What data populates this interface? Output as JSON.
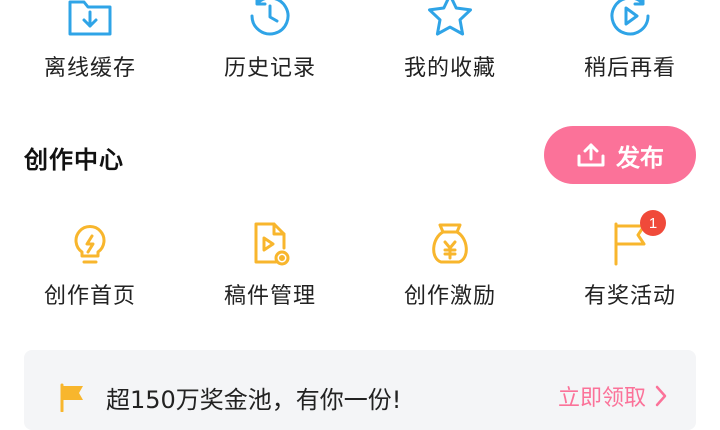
{
  "quick_actions": [
    {
      "label": "离线缓存",
      "icon": "download-folder-icon"
    },
    {
      "label": "历史记录",
      "icon": "history-clock-icon"
    },
    {
      "label": "我的收藏",
      "icon": "star-icon"
    },
    {
      "label": "稍后再看",
      "icon": "play-later-icon"
    }
  ],
  "creation_center": {
    "title": "创作中心",
    "publish_label": "发布",
    "items": [
      {
        "label": "创作首页",
        "icon": "lightbulb-icon"
      },
      {
        "label": "稿件管理",
        "icon": "manuscript-icon"
      },
      {
        "label": "创作激励",
        "icon": "money-bag-icon"
      },
      {
        "label": "有奖活动",
        "icon": "flag-icon",
        "badge": "1"
      }
    ]
  },
  "promo": {
    "text": "超150万奖金池，有你一份!",
    "link_label": "立即领取"
  },
  "colors": {
    "blue_icon": "#2fa4e7",
    "yellow_icon": "#f8b62d",
    "pink_accent": "#fb7299",
    "badge_red": "#f04a3a"
  }
}
